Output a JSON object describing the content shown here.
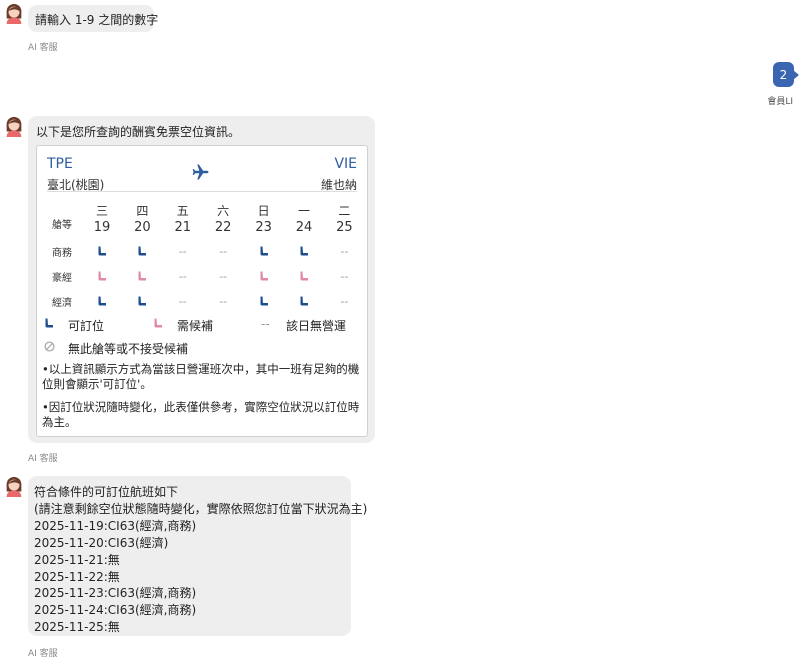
{
  "messages": {
    "bot1": {
      "text": "請輸入 1-9 之間的數字",
      "sender": "AI 客服"
    },
    "user1": {
      "text": "2",
      "sender": "會員LI"
    },
    "bot2": {
      "intro": "以下是您所查詢的酬賓免票空位資訊。",
      "sender": "AI 客服",
      "route": {
        "from_code": "TPE",
        "from_city": "臺北(桃園)",
        "to_code": "VIE",
        "to_city": "維也納"
      },
      "cabin_header": "艙等",
      "days": [
        "三",
        "四",
        "五",
        "六",
        "日",
        "一",
        "二"
      ],
      "dates": [
        "19",
        "20",
        "21",
        "22",
        "23",
        "24",
        "25"
      ],
      "rows": [
        {
          "label": "商務",
          "cells": [
            "available",
            "available",
            "none",
            "none",
            "available",
            "available",
            "none"
          ]
        },
        {
          "label": "豪經",
          "cells": [
            "waitlist",
            "waitlist",
            "none",
            "none",
            "waitlist",
            "waitlist",
            "none"
          ]
        },
        {
          "label": "經濟",
          "cells": [
            "available",
            "available",
            "none",
            "none",
            "available",
            "available",
            "none"
          ]
        }
      ],
      "none_text": "--",
      "legend": {
        "available": "可訂位",
        "waitlist": "需候補",
        "none_symbol": "--",
        "none": "該日無營運",
        "not_accepted": "無此艙等或不接受候補"
      },
      "note1": "•以上資訊顯示方式為當該日營運班次中，其中一班有足夠的機位則會顯示'可訂位'。",
      "note2": "•因訂位狀況隨時變化，此表僅供參考，實際空位狀況以訂位時為主。"
    },
    "bot3": {
      "sender": "AI 客服",
      "lines": [
        "符合條件的可訂位航班如下",
        "(請注意剩餘空位狀態隨時變化，實際依照您訂位當下狀況為主)",
        "2025-11-19:CI63(經濟,商務)",
        "2025-11-20:CI63(經濟)",
        "2025-11-21:無",
        "2025-11-22:無",
        "2025-11-23:CI63(經濟,商務)",
        "2025-11-24:CI63(經濟,商務)",
        "2025-11-25:無"
      ]
    }
  },
  "colors": {
    "available": "#1f4e8f",
    "waitlist": "#e08aa3",
    "user_bubble": "#3a66b1",
    "bubble": "#eeeeee",
    "route_code": "#2e5e9e"
  },
  "icons": {
    "avatar": "woman-avatar-icon",
    "plane": "airplane-icon",
    "seat": "seat-icon",
    "not_accepted": "prohibited-icon"
  }
}
